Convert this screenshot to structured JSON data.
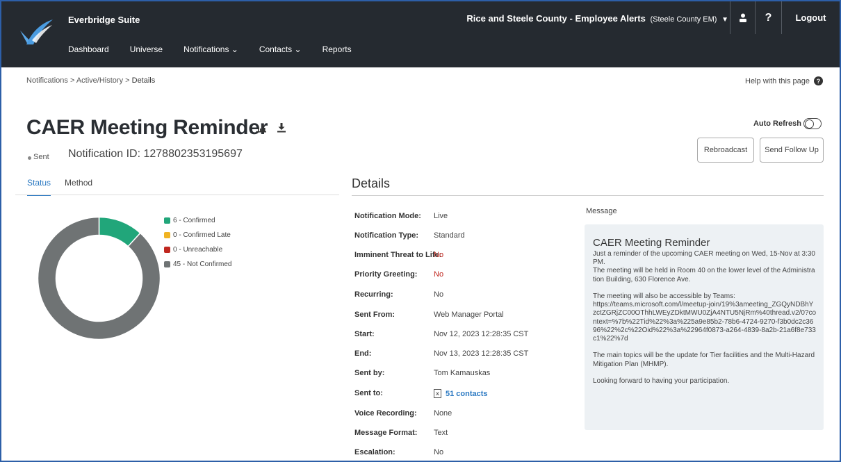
{
  "app": {
    "brand": "Everbridge Suite",
    "org_name": "Rice and Steele County - Employee Alerts",
    "org_sub": "(Steele County EM)",
    "logout": "Logout",
    "help_glyph": "?"
  },
  "nav": [
    {
      "label": "Dashboard"
    },
    {
      "label": "Universe"
    },
    {
      "label": "Notifications ⌄"
    },
    {
      "label": "Contacts ⌄"
    },
    {
      "label": "Reports"
    }
  ],
  "breadcrumb": {
    "path": "Notifications > Active/History > ",
    "current": "Details"
  },
  "help_link": "Help with this page",
  "notification": {
    "title": "CAER Meeting Reminder",
    "status": "Sent",
    "id_text": "Notification ID: 1278802353195697"
  },
  "actions": {
    "auto_refresh": "Auto Refresh",
    "rebroadcast": "Rebroadcast",
    "send_follow_up": "Send Follow Up"
  },
  "tabs": [
    {
      "label": "Status",
      "active": true
    },
    {
      "label": "Method",
      "active": false
    }
  ],
  "chart_data": {
    "type": "pie",
    "categories": [
      "Confirmed",
      "Confirmed Late",
      "Unreachable",
      "Not Confirmed"
    ],
    "values": [
      6,
      0,
      0,
      45
    ],
    "legend": [
      "6 - Confirmed",
      "0 - Confirmed Late",
      "0 - Unreachable",
      "45 - Not Confirmed"
    ],
    "colors": [
      "#21a67a",
      "#f0b323",
      "#c0271f",
      "#6f7374"
    ],
    "legend_position": "right"
  },
  "details": {
    "heading": "Details",
    "rows": [
      {
        "label": "Notification Mode:",
        "value": "Live"
      },
      {
        "label": "Notification Type:",
        "value": "Standard"
      },
      {
        "label": "Imminent Threat to Life:",
        "value": "No"
      },
      {
        "label": "Priority Greeting:",
        "value": "No"
      },
      {
        "label": "Recurring:",
        "value": "No"
      },
      {
        "label": "Sent From:",
        "value": "Web Manager Portal"
      },
      {
        "label": "Start:",
        "value": "Nov 12, 2023 12:28:35 CST"
      },
      {
        "label": "End:",
        "value": "Nov 13, 2023 12:28:35 CST"
      },
      {
        "label": "Sent by:",
        "value": "Tom Kamauskas"
      },
      {
        "label": "Sent to:",
        "value": "51 contacts"
      },
      {
        "label": "Voice Recording:",
        "value": "None"
      },
      {
        "label": "Message Format:",
        "value": "Text"
      },
      {
        "label": "Escalation:",
        "value": "No"
      }
    ]
  },
  "message": {
    "label": "Message",
    "title": "CAER Meeting Reminder",
    "body": "Just a reminder of the upcoming CAER meeting on Wed, 15-Nov at 3:30 PM.\nThe meeting will be held in Room 40 on the lower level of the Administration Building, 630 Florence Ave.\n\nThe meeting will also be accessible by Teams:\nhttps://teams.microsoft.com/l/meetup-join/19%3ameeting_ZGQyNDBhYzctZGRjZC00OThhLWEyZDktMWU0ZjA4NTU5NjRm%40thread.v2/0?context=%7b%22Tid%22%3a%225a9e85b2-78b6-4724-9270-f3b0dc2c3696%22%2c%22Oid%22%3a%22964f0873-a264-4839-8a2b-21a6f8e733c1%22%7d\n\nThe main topics will be the update for Tier facilities and the Multi-Hazard Mitigation Plan (MHMP).\n\nLooking forward to having your participation."
  }
}
